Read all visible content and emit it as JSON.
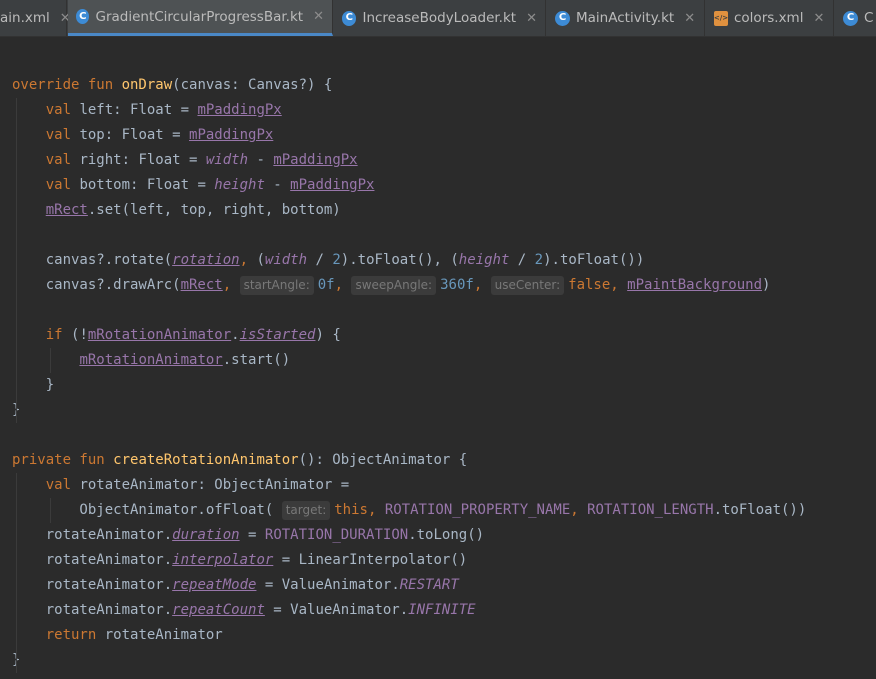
{
  "tabs": [
    {
      "label": "ain.xml",
      "icon": "xml-file-icon"
    },
    {
      "label": "GradientCircularProgressBar.kt",
      "icon": "kotlin-class-icon"
    },
    {
      "label": "IncreaseBodyLoader.kt",
      "icon": "kotlin-class-icon"
    },
    {
      "label": "MainActivity.kt",
      "icon": "kotlin-class-icon"
    },
    {
      "label": "colors.xml",
      "icon": "xml-file-icon"
    },
    {
      "label": "C",
      "icon": "kotlin-class-icon"
    }
  ],
  "tab_close_glyph": "✕",
  "colors": {
    "background": "#2b2b2b",
    "keyword": "#cc7832",
    "function": "#ffc66d",
    "property": "#9876aa",
    "number": "#6897bb",
    "text": "#a9b7c6",
    "active_tab_underline": "#4a88c7"
  },
  "code": [
    [
      [
        "kw",
        "override fun "
      ],
      [
        "fn",
        "onDraw"
      ],
      [
        "",
        "(canvas: Canvas?) {"
      ]
    ],
    [
      [
        "",
        "    "
      ],
      [
        "kw",
        "val "
      ],
      [
        "",
        "left: Float = "
      ],
      [
        "pr ul",
        "mPaddingPx"
      ]
    ],
    [
      [
        "",
        "    "
      ],
      [
        "kw",
        "val "
      ],
      [
        "",
        "top: Float = "
      ],
      [
        "pr ul",
        "mPaddingPx"
      ]
    ],
    [
      [
        "",
        "    "
      ],
      [
        "kw",
        "val "
      ],
      [
        "",
        "right: Float = "
      ],
      [
        "pr it",
        "width"
      ],
      [
        "",
        " - "
      ],
      [
        "pr ul",
        "mPaddingPx"
      ]
    ],
    [
      [
        "",
        "    "
      ],
      [
        "kw",
        "val "
      ],
      [
        "",
        "bottom: Float = "
      ],
      [
        "pr it",
        "height"
      ],
      [
        "",
        " - "
      ],
      [
        "pr ul",
        "mPaddingPx"
      ]
    ],
    [
      [
        "",
        "    "
      ],
      [
        "pr ul",
        "mRect"
      ],
      [
        "",
        ".set(left, top, right, bottom)"
      ]
    ],
    [],
    [
      [
        "",
        "    canvas?.rotate("
      ],
      [
        "pr it ul",
        "rotation"
      ],
      [
        "kw",
        ","
      ],
      [
        "",
        " ("
      ],
      [
        "pr it",
        "width"
      ],
      [
        "",
        " / "
      ],
      [
        "nm",
        "2"
      ],
      [
        "",
        ").toFloat(), ("
      ],
      [
        "pr it",
        "height"
      ],
      [
        "",
        " / "
      ],
      [
        "nm",
        "2"
      ],
      [
        "",
        ").toFloat())"
      ]
    ],
    [
      [
        "",
        "    canvas?.drawArc("
      ],
      [
        "pr ul",
        "mRect"
      ],
      [
        "kw",
        ", "
      ],
      [
        "hint",
        "startAngle:"
      ],
      [
        "nm",
        "0f"
      ],
      [
        "kw",
        ", "
      ],
      [
        "hint",
        "sweepAngle:"
      ],
      [
        "nm",
        "360f"
      ],
      [
        "kw",
        ", "
      ],
      [
        "hint",
        "useCenter:"
      ],
      [
        "kw",
        "false, "
      ],
      [
        "pr ul",
        "mPaintBackground"
      ],
      [
        "",
        ")"
      ]
    ],
    [],
    [
      [
        "",
        "    "
      ],
      [
        "kw",
        "if "
      ],
      [
        "",
        "(!"
      ],
      [
        "pr ul",
        "mRotationAnimator"
      ],
      [
        "",
        "."
      ],
      [
        "pr it ul",
        "isStarted"
      ],
      [
        "",
        ") {"
      ]
    ],
    [
      [
        "",
        "        "
      ],
      [
        "pr ul",
        "mRotationAnimator"
      ],
      [
        "",
        ".start()"
      ]
    ],
    [
      [
        "",
        "    }"
      ]
    ],
    [
      [
        "",
        "}"
      ]
    ],
    [],
    [
      [
        "kw",
        "private fun "
      ],
      [
        "fn",
        "createRotationAnimator"
      ],
      [
        "",
        "(): ObjectAnimator {"
      ]
    ],
    [
      [
        "",
        "    "
      ],
      [
        "kw",
        "val "
      ],
      [
        "",
        "rotateAnimator: ObjectAnimator ="
      ]
    ],
    [
      [
        "",
        "        ObjectAnimator.ofFloat( "
      ],
      [
        "hint",
        "target:"
      ],
      [
        "kw",
        "this, "
      ],
      [
        "pr",
        "ROTATION_PROPERTY_NAME"
      ],
      [
        "kw",
        ", "
      ],
      [
        "pr",
        "ROTATION_LENGTH"
      ],
      [
        "",
        ".toFloat())"
      ]
    ],
    [
      [
        "",
        "    rotateAnimator."
      ],
      [
        "pr it ul",
        "duration"
      ],
      [
        "",
        " = "
      ],
      [
        "pr",
        "ROTATION_DURATION"
      ],
      [
        "",
        ".toLong()"
      ]
    ],
    [
      [
        "",
        "    rotateAnimator."
      ],
      [
        "pr it ul",
        "interpolator"
      ],
      [
        "",
        " = LinearInterpolator()"
      ]
    ],
    [
      [
        "",
        "    rotateAnimator."
      ],
      [
        "pr it ul",
        "repeatMode"
      ],
      [
        "",
        " = ValueAnimator."
      ],
      [
        "pr it",
        "RESTART"
      ]
    ],
    [
      [
        "",
        "    rotateAnimator."
      ],
      [
        "pr it ul",
        "repeatCount"
      ],
      [
        "",
        " = ValueAnimator."
      ],
      [
        "pr it",
        "INFINITE"
      ]
    ],
    [
      [
        "",
        "    "
      ],
      [
        "kw",
        "return "
      ],
      [
        "",
        "rotateAnimator"
      ]
    ],
    [
      [
        "",
        "}"
      ]
    ]
  ]
}
